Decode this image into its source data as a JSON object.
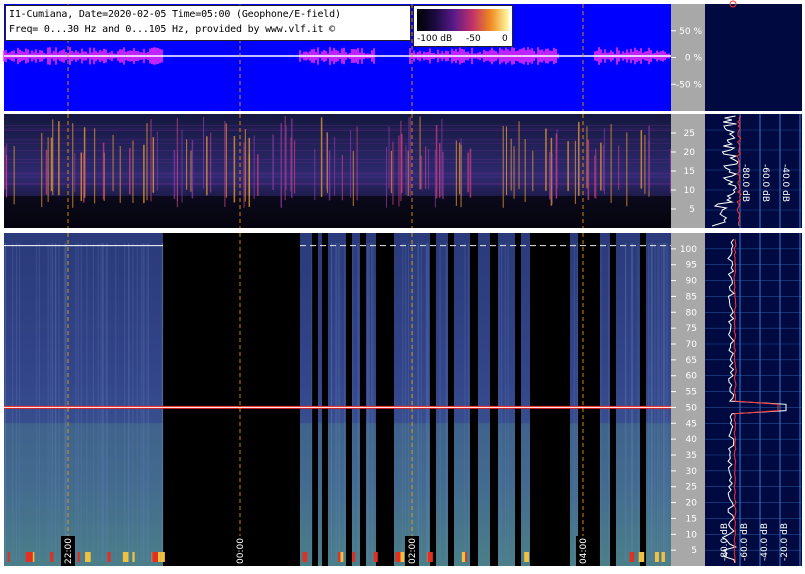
{
  "header": {
    "title_line1": "I1-Cumiana, Date=2020-02-05 Time=05:00 (Geophone/E-field)",
    "title_line2": "Freq= 0...30 Hz and 0...105 Hz, provided by www.vlf.it ©"
  },
  "colorbar": {
    "label_min": "-100 dB",
    "label_mid": "-50",
    "label_max": "0",
    "colors": [
      "#000000",
      "#1a0b40",
      "#5a1a8a",
      "#c0306a",
      "#f08a20",
      "#ffffaa"
    ]
  },
  "chart_data": [
    {
      "type": "line",
      "name": "waveform panel",
      "y_tick_labels": [
        "50 %",
        "0 %",
        "-50 %"
      ],
      "y_ticks": [
        50,
        0,
        -50
      ],
      "ylim": [
        -100,
        100
      ],
      "background": "#0000ff"
    },
    {
      "type": "heatmap",
      "name": "0-30 Hz spectrogram",
      "y_tick_labels": [
        "25",
        "20",
        "15",
        "10",
        "5"
      ],
      "ylim": [
        0,
        30
      ],
      "side_axis_labels": [
        "-80.0 dB",
        "-60.0 dB",
        "-40.0 dB",
        "-20.0 dB"
      ]
    },
    {
      "type": "heatmap",
      "name": "0-105 Hz spectrogram",
      "y_tick_labels": [
        "100",
        "95",
        "90",
        "85",
        "80",
        "75",
        "70",
        "65",
        "60",
        "55",
        "50",
        "45",
        "40",
        "35",
        "30",
        "25",
        "20",
        "15",
        "10",
        "5"
      ],
      "ylim": [
        0,
        105
      ],
      "x_tick_labels": [
        "22:00",
        "00:00",
        "02:00",
        "04:00"
      ],
      "side_axis_labels": [
        "-80.0 dB",
        "-60.0 dB",
        "-40.0 dB",
        "-20.0 dB"
      ],
      "mains_hum_hz": 50
    }
  ]
}
